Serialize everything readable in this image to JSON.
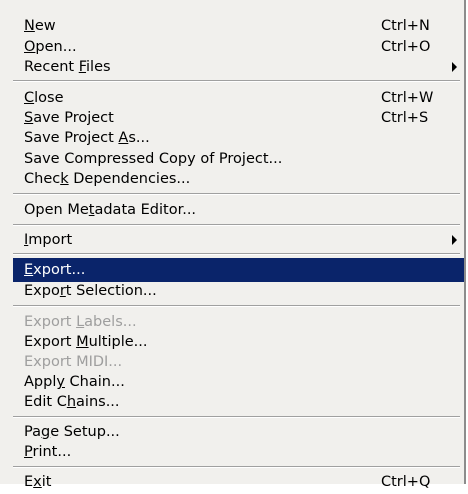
{
  "menu": {
    "new": {
      "pre": "",
      "u": "N",
      "post": "ew",
      "shortcut": "Ctrl+N"
    },
    "open": {
      "pre": "",
      "u": "O",
      "post": "pen...",
      "shortcut": "Ctrl+O"
    },
    "recent": {
      "pre": "Recent ",
      "u": "F",
      "post": "iles"
    },
    "close": {
      "pre": "",
      "u": "C",
      "post": "lose",
      "shortcut": "Ctrl+W"
    },
    "save": {
      "pre": "",
      "u": "S",
      "post": "ave Project",
      "shortcut": "Ctrl+S"
    },
    "save_as": {
      "pre": "Save Project ",
      "u": "A",
      "post": "s..."
    },
    "save_comp": {
      "pre": "Save Compressed Copy of Project...",
      "u": "",
      "post": ""
    },
    "check_deps": {
      "pre": "Chec",
      "u": "k",
      "post": " Dependencies..."
    },
    "metadata": {
      "pre": "Open Me",
      "u": "t",
      "post": "adata Editor..."
    },
    "import": {
      "pre": "",
      "u": "I",
      "post": "mport"
    },
    "export": {
      "pre": "",
      "u": "E",
      "post": "xport..."
    },
    "export_sel": {
      "pre": "Expo",
      "u": "r",
      "post": "t Selection..."
    },
    "export_labels": {
      "pre": "Export ",
      "u": "L",
      "post": "abels..."
    },
    "export_multiple": {
      "pre": "Export ",
      "u": "M",
      "post": "ultiple..."
    },
    "export_midi": {
      "pre": "Export MIDI...",
      "u": "",
      "post": ""
    },
    "apply_chain": {
      "pre": "Appl",
      "u": "y",
      "post": " Chain..."
    },
    "edit_chains": {
      "pre": "Edit C",
      "u": "h",
      "post": "ains..."
    },
    "page_setup": {
      "pre": "Pa",
      "u": "g",
      "post": "e Setup..."
    },
    "print": {
      "pre": "",
      "u": "P",
      "post": "rint..."
    },
    "exit": {
      "pre": "E",
      "u": "x",
      "post": "it",
      "shortcut": "Ctrl+Q"
    }
  }
}
